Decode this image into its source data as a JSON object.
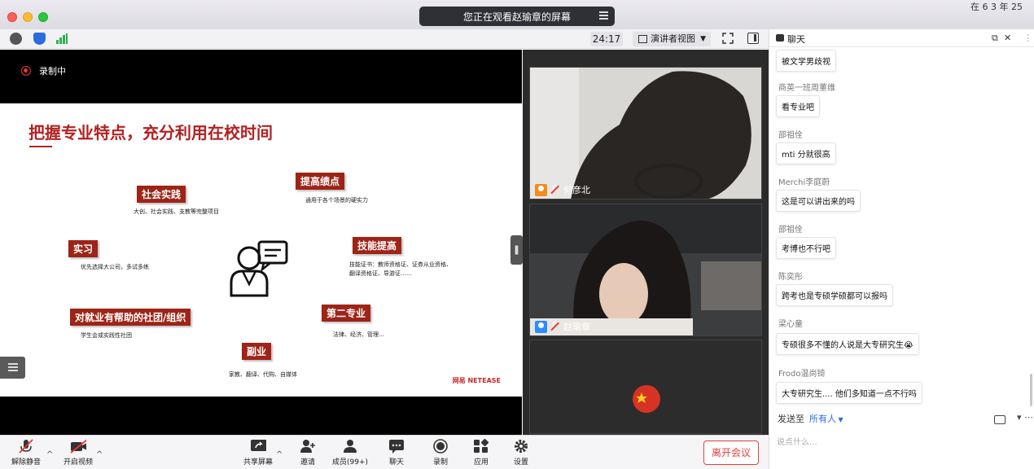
{
  "titlebar": {
    "share_banner": "您正在观看赵瑜章的屏幕",
    "clock": "在 6 3 年 25 "
  },
  "toolbar": {
    "timer": "24:17",
    "view_mode": "演讲者视图"
  },
  "share": {
    "recording_label": "录制中",
    "slide": {
      "title": "把握专业特点，充分利用在校时间",
      "items": [
        {
          "tag": "社会实践",
          "note": "大创、社会实践、支教等完整项目"
        },
        {
          "tag": "提高绩点",
          "note": "通用于各个场景的硬实力"
        },
        {
          "tag": "实习",
          "note": "优先选择大公司，多试多练"
        },
        {
          "tag": "技能提高",
          "note": "技能证书：教师资格证、证券从业资格、",
          "note2": "翻译资格证、导游证……"
        },
        {
          "tag": "对就业有帮助的社团/组织",
          "note": "学生会或实践性社团"
        },
        {
          "tag": "第二专业",
          "note": "法律、经济、管理…"
        },
        {
          "tag": "副业",
          "note": "家教、翻译、代购、自媒体"
        }
      ],
      "brand": "网易 NETEASE"
    }
  },
  "participants": [
    {
      "name": "何彦北"
    },
    {
      "name": "赵瑜章"
    },
    {
      "name": ""
    }
  ],
  "bottom_bar": {
    "mute": "解除静音",
    "video": "开启视频",
    "share": "共享屏幕",
    "invite": "邀请",
    "members": "成员(99+)",
    "chat": "聊天",
    "record": "录制",
    "apps": "应用",
    "settings": "设置",
    "leave": "离开会议"
  },
  "chat": {
    "title": "聊天",
    "messages": [
      {
        "sender": "",
        "text": "被文学男歧视"
      },
      {
        "sender": "商英一班周董维",
        "text": "看专业吧"
      },
      {
        "sender": "邵祖佺",
        "text": "mti 分就很高"
      },
      {
        "sender": "Merchi李庭蔚",
        "text": "这是可以讲出来的吗"
      },
      {
        "sender": "邵祖佺",
        "text": "考博也不行吧"
      },
      {
        "sender": "陈奕彤",
        "text": "跨考也是专硕学硕都可以报吗"
      },
      {
        "sender": "梁心童",
        "text": "专硕很多不懂的人说是大专研究生😭"
      },
      {
        "sender": "Frodo温尚锜",
        "text": "大专研究生.... 他们多知道一点不行吗"
      }
    ],
    "send_to_label": "发送至",
    "send_to_target": "所有人",
    "input_placeholder": "说点什么..."
  }
}
